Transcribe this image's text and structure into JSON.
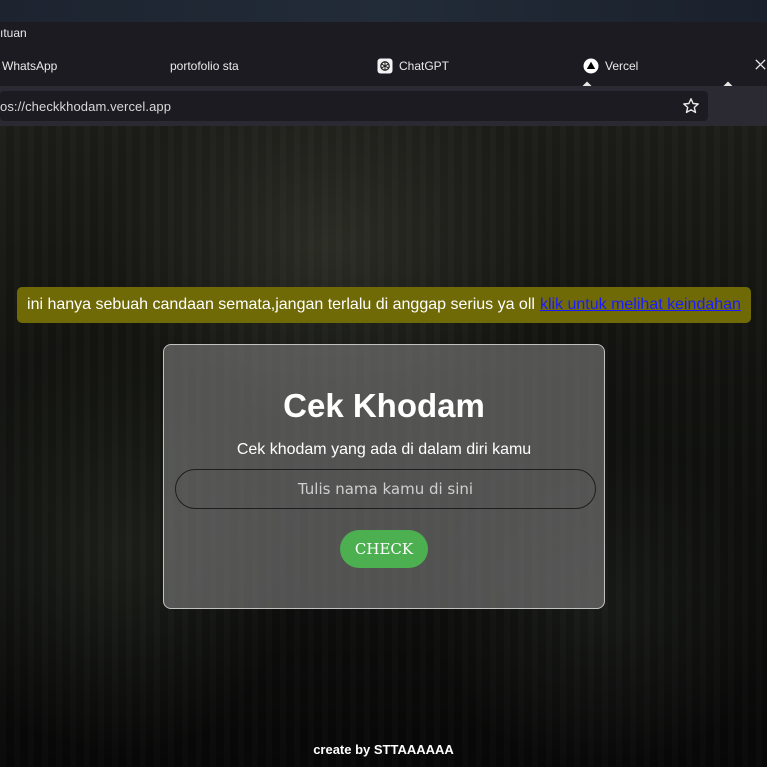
{
  "browser": {
    "menu_label": "ıtuan",
    "tabs": [
      {
        "label": "WhatsApp",
        "icon": "none"
      },
      {
        "label": "portofolio sta",
        "icon": "none"
      },
      {
        "label": "ChatGPT",
        "icon": "chatgpt-icon"
      },
      {
        "label": "Vercel",
        "icon": "vercel-icon"
      }
    ],
    "url": "os://checkkhodam.vercel.app"
  },
  "page": {
    "notice": {
      "text": "ini hanya sebuah candaan semata,jangan terlalu di anggap serius ya oll",
      "link": "klik untuk melihat keindahan"
    },
    "card": {
      "title": "Cek Khodam",
      "subtitle": "Cek khodam yang ada di dalam diri kamu",
      "input_placeholder": "Tulis nama kamu di sini",
      "input_value": "",
      "button_label": "CHECK"
    },
    "footer": "create by STTAAAAAA"
  },
  "colors": {
    "notice_bg": "#6f6a05",
    "link": "#1a1aff",
    "button_bg": "#4caf50"
  }
}
